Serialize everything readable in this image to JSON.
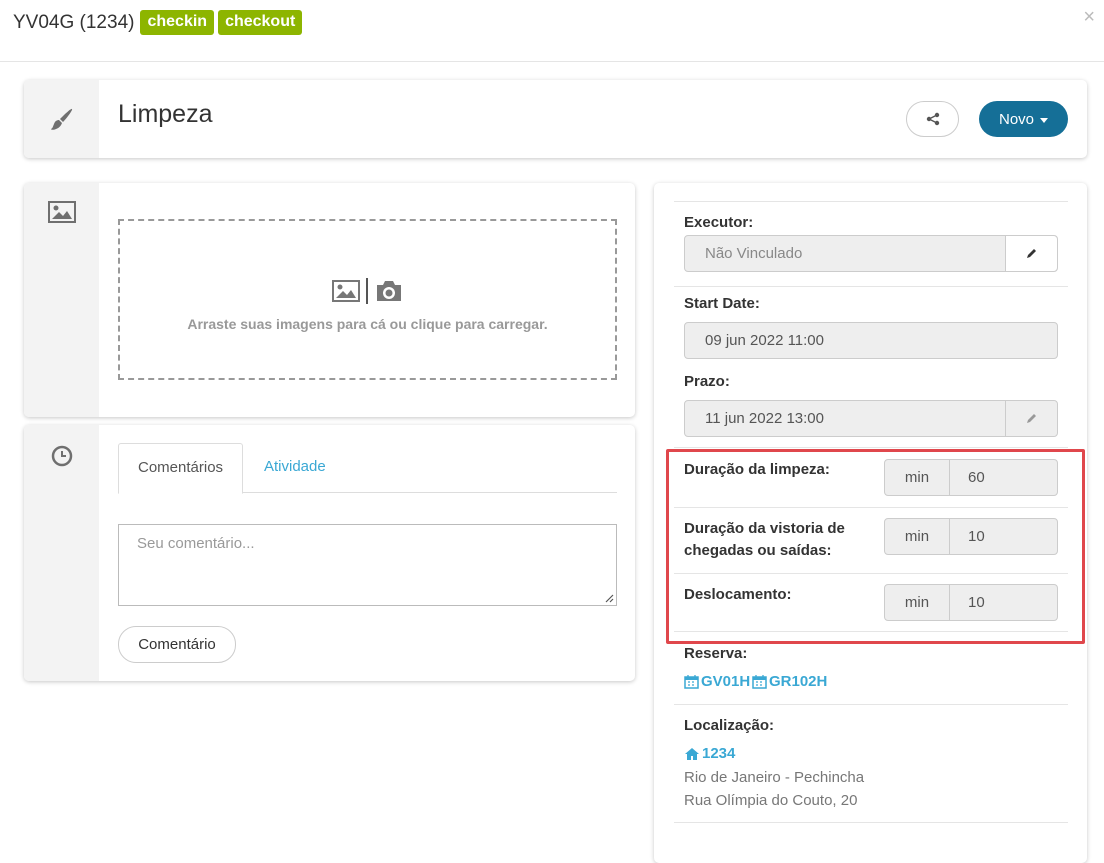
{
  "header": {
    "code": "YV04G (1234)",
    "badges": [
      "checkin",
      "checkout"
    ],
    "close": "×"
  },
  "title_card": {
    "title": "Limpeza",
    "new_button": "Novo"
  },
  "images": {
    "dropzone_text": "Arraste suas imagens para cá ou clique para carregar."
  },
  "comments": {
    "tabs": [
      "Comentários",
      "Atividade"
    ],
    "placeholder": "Seu comentário...",
    "submit": "Comentário"
  },
  "details": {
    "executor": {
      "label": "Executor:",
      "value": "Não Vinculado"
    },
    "start_date": {
      "label": "Start Date:",
      "value": "09 jun 2022 11:00"
    },
    "prazo": {
      "label": "Prazo:",
      "value": "11 jun 2022 13:00"
    },
    "durations": [
      {
        "label": "Duração da limpeza:",
        "unit": "min",
        "value": "60"
      },
      {
        "label_line1": "Duração da vistoria de",
        "label_line2": "chegadas ou saídas:",
        "unit": "min",
        "value": "10"
      },
      {
        "label": "Deslocamento:",
        "unit": "min",
        "value": "10"
      }
    ],
    "reserva": {
      "label": "Reserva:",
      "links": [
        "GV01H",
        "GR102H"
      ]
    },
    "localizacao": {
      "label": "Localização:",
      "link": "1234",
      "city": "Rio de Janeiro - Pechincha",
      "street": "Rua Olímpia do Couto, 20"
    }
  },
  "colors": {
    "badge": "#8db500",
    "primary_button": "#156f97",
    "link": "#3aa8d4",
    "highlight": "#e0474c"
  }
}
